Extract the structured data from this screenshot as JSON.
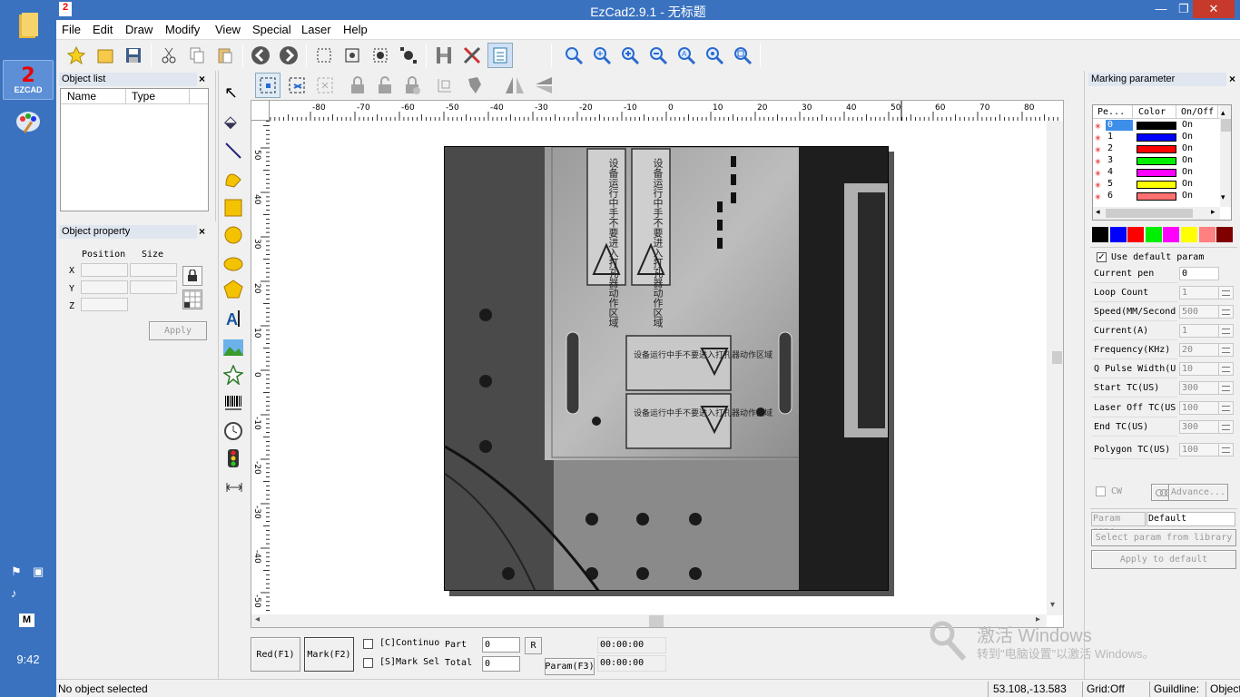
{
  "window": {
    "title": "EzCad2.9.1 - 无标题",
    "min": "—",
    "restore": "❐",
    "close": "✕"
  },
  "taskbar": {
    "clock": "9:42",
    "app_badge": "2",
    "app_label": "EZCAD",
    "ime": "M"
  },
  "menu": [
    "File",
    "Edit",
    "Draw",
    "Modify",
    "View",
    "Special",
    "Laser",
    "Help"
  ],
  "object_list": {
    "title": "Object list",
    "columns": [
      "Name",
      "Type"
    ]
  },
  "object_property": {
    "title": "Object property",
    "position_label": "Position",
    "size_label": "Size",
    "axes": [
      "X",
      "Y",
      "Z"
    ],
    "apply": "Apply"
  },
  "ruler": {
    "h_ticks": [
      "-80",
      "-70",
      "-60",
      "-50",
      "-40",
      "-30",
      "-20",
      "-10",
      "0",
      "10",
      "20",
      "30",
      "40",
      "50",
      "60",
      "70",
      "80"
    ],
    "v_ticks": [
      "50",
      "40",
      "30",
      "20",
      "10",
      "0",
      "-10",
      "-20",
      "-30",
      "-40",
      "-50"
    ]
  },
  "image": {
    "warning_text_a": "设备运行中手不要进入打孔器动作区域",
    "warning_text_b": "设备运行中手不要进入打孔器动作区域",
    "warning_text_c": "设备运行中手不要进入打孔器动作区域",
    "warning_text_d": "设备运行中手不要进入打孔器动作区域"
  },
  "bottom": {
    "red_btn": "Red(F1)",
    "mark_btn": "Mark(F2)",
    "continuous": "[C]Continuo",
    "mark_sel": "[S]Mark Sel",
    "part_label": "Part",
    "part_value": "0",
    "total_label": "Total",
    "total_value": "0",
    "r_btn": "R",
    "param_btn": "Param(F3)",
    "time1": "00:00:00",
    "time2": "00:00:00"
  },
  "marking": {
    "title": "Marking parameter",
    "columns": [
      "Pe...",
      "Color",
      "On/Off"
    ],
    "pens": [
      {
        "id": "0",
        "color": "#000000",
        "state": "On"
      },
      {
        "id": "1",
        "color": "#0000ff",
        "state": "On"
      },
      {
        "id": "2",
        "color": "#ff0000",
        "state": "On"
      },
      {
        "id": "3",
        "color": "#00ee00",
        "state": "On"
      },
      {
        "id": "4",
        "color": "#ff00ff",
        "state": "On"
      },
      {
        "id": "5",
        "color": "#ffff00",
        "state": "On"
      },
      {
        "id": "6",
        "color": "#ff7070",
        "state": "On"
      }
    ],
    "palette": [
      "#000000",
      "#0000ff",
      "#ff0000",
      "#00ee00",
      "#ff00ff",
      "#ffff00",
      "#ff8080",
      "#800000"
    ],
    "use_default": "Use default param",
    "params": [
      {
        "label": "Current pen",
        "value": "0"
      },
      {
        "label": "Loop Count",
        "value": "1"
      },
      {
        "label": "Speed(MM/Second",
        "value": "500"
      },
      {
        "label": "Current(A)",
        "value": "1"
      },
      {
        "label": "Frequency(KHz)",
        "value": "20"
      },
      {
        "label": "Q Pulse Width(U",
        "value": "10"
      },
      {
        "label": "Start TC(US)",
        "value": "300"
      },
      {
        "label": "Laser Off TC(US",
        "value": "100"
      },
      {
        "label": "End TC(US)",
        "value": "300"
      },
      {
        "label": "Polygon TC(US)",
        "value": "100"
      }
    ],
    "cw": "CW",
    "advance": "Advance...",
    "param_name_label": "Param name",
    "param_name_value": "Default",
    "select_lib": "Select param from library",
    "apply_default": "Apply to default"
  },
  "watermark": {
    "line1": "激活 Windows",
    "line2": "转到\"电脑设置\"以激活 Windows。"
  },
  "status": {
    "message": "No object selected",
    "coords": "53.108,-13.583",
    "grid": "Grid:Off",
    "guideline": "Guildline:",
    "object": "Object:Ot"
  }
}
